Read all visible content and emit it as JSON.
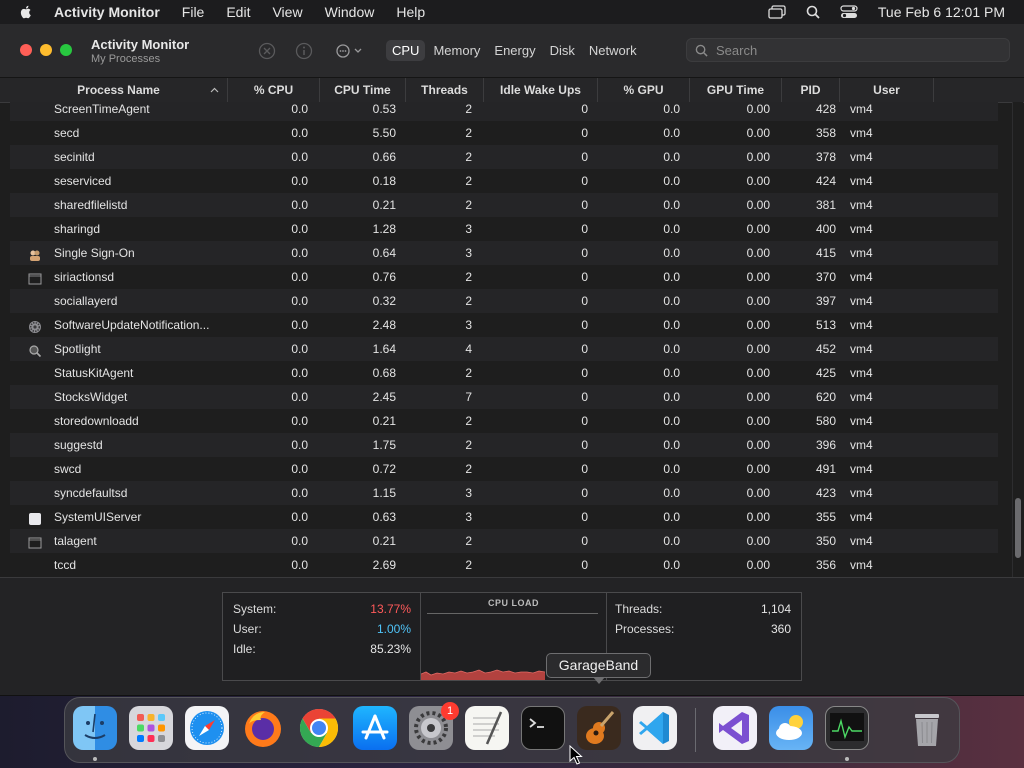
{
  "menubar": {
    "app_name": "Activity Monitor",
    "items": [
      "File",
      "Edit",
      "View",
      "Window",
      "Help"
    ],
    "clock": "Tue Feb 6  12:01 PM"
  },
  "window": {
    "title": "Activity Monitor",
    "subtitle": "My Processes",
    "tabs": [
      {
        "label": "CPU",
        "active": true
      },
      {
        "label": "Memory",
        "active": false
      },
      {
        "label": "Energy",
        "active": false
      },
      {
        "label": "Disk",
        "active": false
      },
      {
        "label": "Network",
        "active": false
      }
    ],
    "search_placeholder": "Search"
  },
  "table": {
    "columns": [
      "Process Name",
      "% CPU",
      "CPU Time",
      "Threads",
      "Idle Wake Ups",
      "% GPU",
      "GPU Time",
      "PID",
      "User"
    ],
    "rows": [
      {
        "name": "ScreenTimeAgent",
        "cpu": "0.0",
        "cpu_time": "0.53",
        "threads": "2",
        "idle": "0",
        "gpu": "0.0",
        "gpu_time": "0.00",
        "pid": "428",
        "user": "vm4",
        "icon": ""
      },
      {
        "name": "secd",
        "cpu": "0.0",
        "cpu_time": "5.50",
        "threads": "2",
        "idle": "0",
        "gpu": "0.0",
        "gpu_time": "0.00",
        "pid": "358",
        "user": "vm4",
        "icon": ""
      },
      {
        "name": "secinitd",
        "cpu": "0.0",
        "cpu_time": "0.66",
        "threads": "2",
        "idle": "0",
        "gpu": "0.0",
        "gpu_time": "0.00",
        "pid": "378",
        "user": "vm4",
        "icon": ""
      },
      {
        "name": "seserviced",
        "cpu": "0.0",
        "cpu_time": "0.18",
        "threads": "2",
        "idle": "0",
        "gpu": "0.0",
        "gpu_time": "0.00",
        "pid": "424",
        "user": "vm4",
        "icon": ""
      },
      {
        "name": "sharedfilelistd",
        "cpu": "0.0",
        "cpu_time": "0.21",
        "threads": "2",
        "idle": "0",
        "gpu": "0.0",
        "gpu_time": "0.00",
        "pid": "381",
        "user": "vm4",
        "icon": ""
      },
      {
        "name": "sharingd",
        "cpu": "0.0",
        "cpu_time": "1.28",
        "threads": "3",
        "idle": "0",
        "gpu": "0.0",
        "gpu_time": "0.00",
        "pid": "400",
        "user": "vm4",
        "icon": ""
      },
      {
        "name": "Single Sign-On",
        "cpu": "0.0",
        "cpu_time": "0.64",
        "threads": "3",
        "idle": "0",
        "gpu": "0.0",
        "gpu_time": "0.00",
        "pid": "415",
        "user": "vm4",
        "icon": "sso-icon"
      },
      {
        "name": "siriactionsd",
        "cpu": "0.0",
        "cpu_time": "0.76",
        "threads": "2",
        "idle": "0",
        "gpu": "0.0",
        "gpu_time": "0.00",
        "pid": "370",
        "user": "vm4",
        "icon": "terminal-window-icon"
      },
      {
        "name": "sociallayerd",
        "cpu": "0.0",
        "cpu_time": "0.32",
        "threads": "2",
        "idle": "0",
        "gpu": "0.0",
        "gpu_time": "0.00",
        "pid": "397",
        "user": "vm4",
        "icon": ""
      },
      {
        "name": "SoftwareUpdateNotification...",
        "cpu": "0.0",
        "cpu_time": "2.48",
        "threads": "3",
        "idle": "0",
        "gpu": "0.0",
        "gpu_time": "0.00",
        "pid": "513",
        "user": "vm4",
        "icon": "gear-icon"
      },
      {
        "name": "Spotlight",
        "cpu": "0.0",
        "cpu_time": "1.64",
        "threads": "4",
        "idle": "0",
        "gpu": "0.0",
        "gpu_time": "0.00",
        "pid": "452",
        "user": "vm4",
        "icon": "magnifier-icon"
      },
      {
        "name": "StatusKitAgent",
        "cpu": "0.0",
        "cpu_time": "0.68",
        "threads": "2",
        "idle": "0",
        "gpu": "0.0",
        "gpu_time": "0.00",
        "pid": "425",
        "user": "vm4",
        "icon": ""
      },
      {
        "name": "StocksWidget",
        "cpu": "0.0",
        "cpu_time": "2.45",
        "threads": "7",
        "idle": "0",
        "gpu": "0.0",
        "gpu_time": "0.00",
        "pid": "620",
        "user": "vm4",
        "icon": ""
      },
      {
        "name": "storedownloadd",
        "cpu": "0.0",
        "cpu_time": "0.21",
        "threads": "2",
        "idle": "0",
        "gpu": "0.0",
        "gpu_time": "0.00",
        "pid": "580",
        "user": "vm4",
        "icon": ""
      },
      {
        "name": "suggestd",
        "cpu": "0.0",
        "cpu_time": "1.75",
        "threads": "2",
        "idle": "0",
        "gpu": "0.0",
        "gpu_time": "0.00",
        "pid": "396",
        "user": "vm4",
        "icon": ""
      },
      {
        "name": "swcd",
        "cpu": "0.0",
        "cpu_time": "0.72",
        "threads": "2",
        "idle": "0",
        "gpu": "0.0",
        "gpu_time": "0.00",
        "pid": "491",
        "user": "vm4",
        "icon": ""
      },
      {
        "name": "syncdefaultsd",
        "cpu": "0.0",
        "cpu_time": "1.15",
        "threads": "3",
        "idle": "0",
        "gpu": "0.0",
        "gpu_time": "0.00",
        "pid": "423",
        "user": "vm4",
        "icon": ""
      },
      {
        "name": "SystemUIServer",
        "cpu": "0.0",
        "cpu_time": "0.63",
        "threads": "3",
        "idle": "0",
        "gpu": "0.0",
        "gpu_time": "0.00",
        "pid": "355",
        "user": "vm4",
        "icon": "white-square-icon"
      },
      {
        "name": "talagent",
        "cpu": "0.0",
        "cpu_time": "0.21",
        "threads": "2",
        "idle": "0",
        "gpu": "0.0",
        "gpu_time": "0.00",
        "pid": "350",
        "user": "vm4",
        "icon": "terminal-window-icon"
      },
      {
        "name": "tccd",
        "cpu": "0.0",
        "cpu_time": "2.69",
        "threads": "2",
        "idle": "0",
        "gpu": "0.0",
        "gpu_time": "0.00",
        "pid": "356",
        "user": "vm4",
        "icon": ""
      }
    ]
  },
  "stats": {
    "system_label": "System:",
    "system_value": "13.77%",
    "system_color": "#ff5a5a",
    "user_label": "User:",
    "user_value": "1.00%",
    "user_color": "#4fc3f7",
    "idle_label": "Idle:",
    "idle_value": "85.23%",
    "cpu_load_title": "CPU LOAD",
    "threads_label": "Threads:",
    "threads_value": "1,104",
    "processes_label": "Processes:",
    "processes_value": "360"
  },
  "tooltip": "GarageBand",
  "dock": {
    "items": [
      {
        "name": "finder",
        "running": true
      },
      {
        "name": "launchpad",
        "running": false
      },
      {
        "name": "safari",
        "running": false
      },
      {
        "name": "firefox",
        "running": false
      },
      {
        "name": "chrome",
        "running": false
      },
      {
        "name": "app-store",
        "running": false
      },
      {
        "name": "system-settings",
        "running": false
      },
      {
        "name": "textedit",
        "running": false
      },
      {
        "name": "terminal",
        "running": false
      },
      {
        "name": "garageband",
        "running": false
      },
      {
        "name": "vscode",
        "running": false
      },
      {
        "name": "visual-studio",
        "running": false
      },
      {
        "name": "weather",
        "running": false
      },
      {
        "name": "activity-monitor",
        "running": true
      },
      {
        "name": "trash",
        "running": false
      }
    ],
    "settings_badge": "1"
  },
  "colors": {
    "accent_red": "#ff5f57",
    "accent_yellow": "#febc2e",
    "accent_green": "#28c840"
  }
}
